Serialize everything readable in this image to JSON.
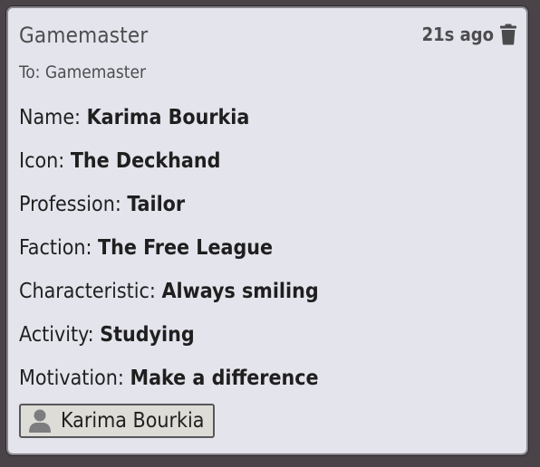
{
  "message": {
    "sender": "Gamemaster",
    "timestamp": "21s ago",
    "recipient": "To: Gamemaster",
    "fields": [
      {
        "label": "Name:",
        "value": "Karima Bourkia"
      },
      {
        "label": "Icon:",
        "value": "The Deckhand"
      },
      {
        "label": "Profession:",
        "value": "Tailor"
      },
      {
        "label": "Faction:",
        "value": "The Free League"
      },
      {
        "label": "Characteristic:",
        "value": "Always smiling"
      },
      {
        "label": "Activity:",
        "value": "Studying"
      },
      {
        "label": "Motivation:",
        "value": "Make a difference"
      }
    ],
    "actor_link": {
      "name": "Karima Bourkia",
      "icon": "user-icon"
    },
    "delete_icon": "trash-icon"
  }
}
